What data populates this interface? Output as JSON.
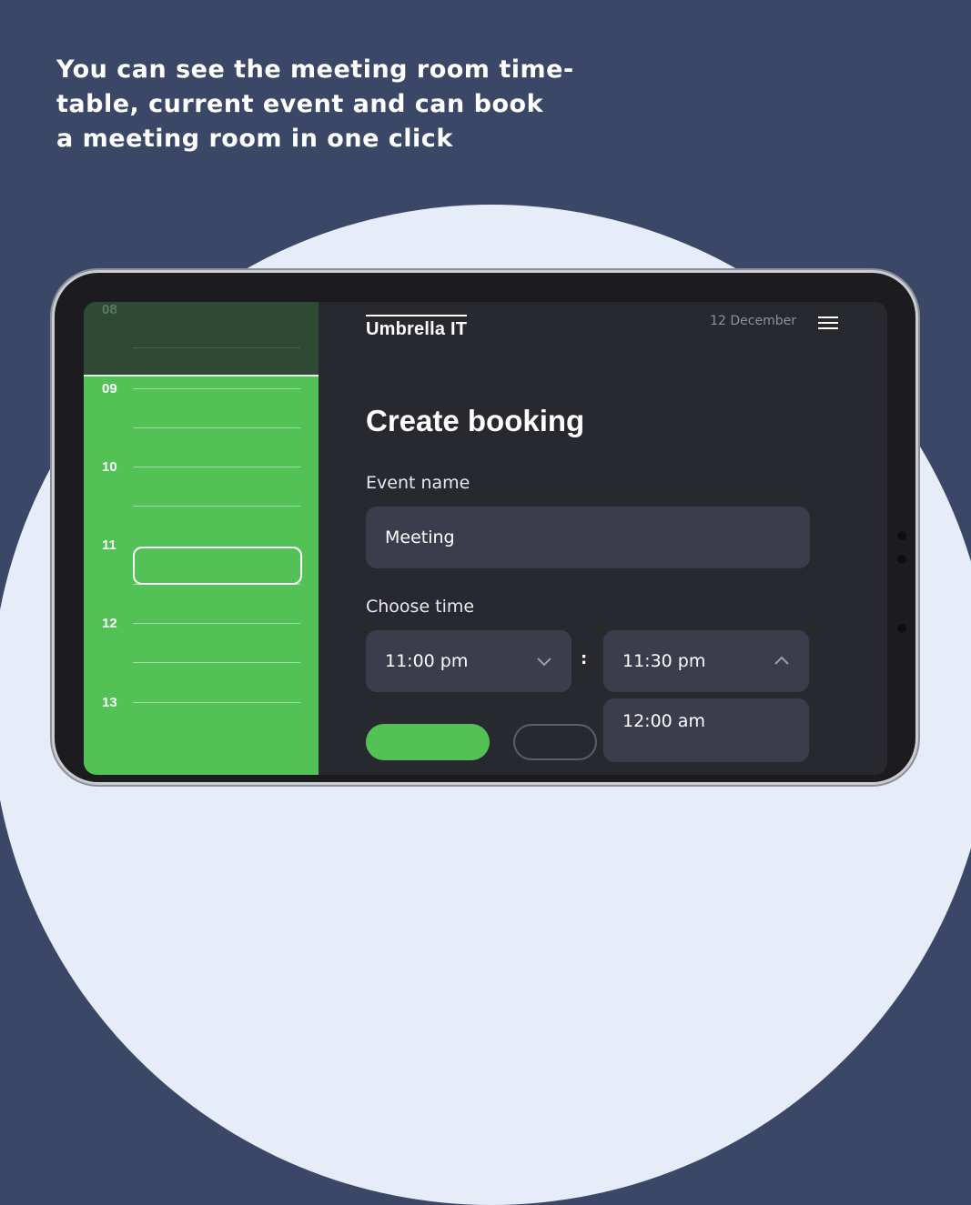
{
  "headline": {
    "lines": [
      "You can see the meeting room time-",
      "table, current event and can book",
      "a meeting room in one click"
    ]
  },
  "timeline": {
    "hours": [
      "08",
      "09",
      "10",
      "11",
      "12",
      "13"
    ]
  },
  "header": {
    "logo": "Umbrella IT",
    "date": "12 December",
    "menu_icon": "hamburger-menu-icon"
  },
  "form": {
    "title": "Create booking",
    "event_name_label": "Event name",
    "event_name_value": "Meeting",
    "choose_time_label": "Choose time",
    "start_time": "11:00 pm",
    "end_time": "11:30 pm",
    "separator": ":",
    "end_time_options": [
      "12:00 am"
    ]
  },
  "colors": {
    "background": "#3a4766",
    "accent_green": "#52c257",
    "panel_dark": "#28292e",
    "field": "#3b3d4c"
  }
}
